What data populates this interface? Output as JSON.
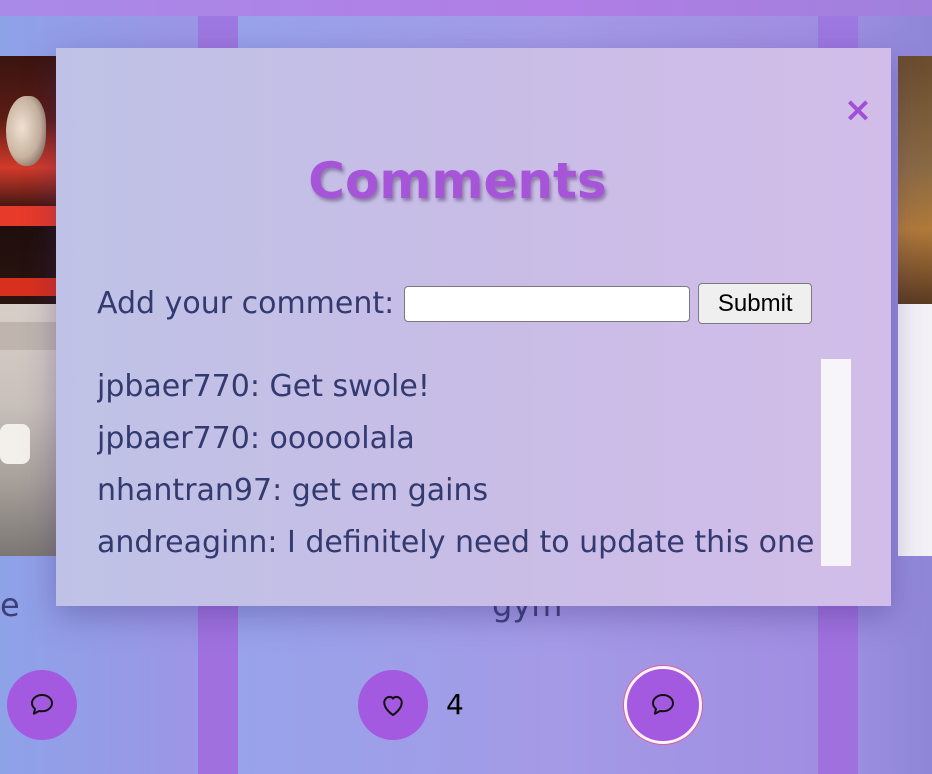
{
  "background": {
    "left_card_title": "e",
    "center_card_title": "gym",
    "like_count": "4"
  },
  "modal": {
    "title": "Comments",
    "close_label": "×",
    "form": {
      "label": "Add your comment:",
      "input_value": "",
      "submit_label": "Submit"
    },
    "comments": [
      {
        "text": "jpbaer770: Get swole!"
      },
      {
        "text": "jpbaer770: ooooolala"
      },
      {
        "text": "nhantran97: get em gains"
      },
      {
        "text": "andreaginn: I definitely need to update this one"
      }
    ]
  },
  "colors": {
    "accent": "#a755d8",
    "button_purple": "#a45ae0",
    "text_navy": "#333a70"
  },
  "icons": {
    "close": "close-icon",
    "comment": "comment-bubble-icon",
    "heart": "heart-icon"
  }
}
